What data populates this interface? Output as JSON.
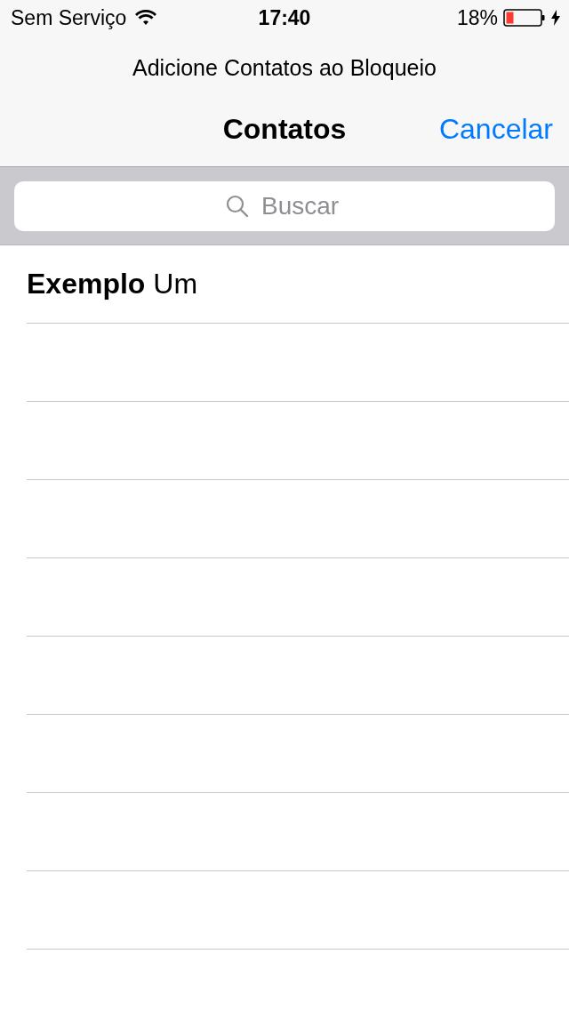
{
  "status_bar": {
    "carrier": "Sem Serviço",
    "time": "17:40",
    "battery": "18%"
  },
  "navigation": {
    "prompt": "Adicione Contatos ao Bloqueio",
    "title": "Contatos",
    "cancel": "Cancelar"
  },
  "search": {
    "placeholder": "Buscar"
  },
  "contacts": [
    {
      "name": "**Exemplo** Um"
    }
  ]
}
